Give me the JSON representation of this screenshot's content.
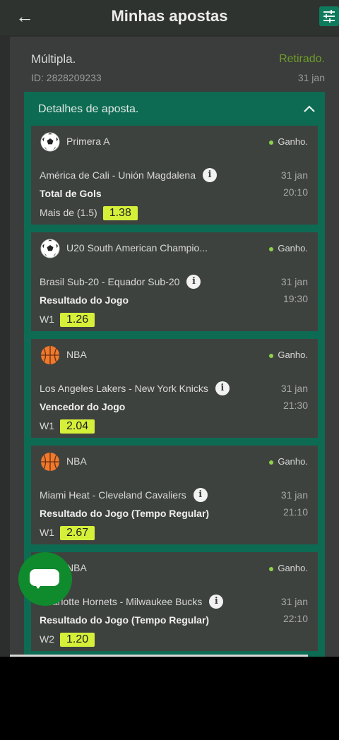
{
  "header": {
    "title": "Minhas apostas",
    "back_icon": "arrow-left-icon",
    "filter_icon": "sliders-icon"
  },
  "bet": {
    "type": "Múltipla.",
    "id": "ID: 2828209233",
    "status": "Retirado.",
    "date": "31 jan"
  },
  "details": {
    "label": "Detalhes de aposta."
  },
  "legs": [
    {
      "sport": "soccer",
      "league": "Primera A",
      "result": "Ganho.",
      "teams": "América de Cali - Unión Magdalena",
      "date": "31 jan",
      "time": "20:10",
      "market": "Total de Gols",
      "pick": "Mais de (1.5)",
      "odds": "1.38"
    },
    {
      "sport": "soccer",
      "league": "U20 South American Champio...",
      "result": "Ganho.",
      "teams": "Brasil Sub-20 - Equador Sub-20",
      "date": "31 jan",
      "time": "19:30",
      "market": "Resultado do Jogo",
      "pick": "W1",
      "odds": "1.26"
    },
    {
      "sport": "basketball",
      "league": "NBA",
      "result": "Ganho.",
      "teams": "Los Angeles Lakers - New York Knicks",
      "date": "31 jan",
      "time": "21:30",
      "market": "Vencedor do Jogo",
      "pick": "W1",
      "odds": "2.04"
    },
    {
      "sport": "basketball",
      "league": "NBA",
      "result": "Ganho.",
      "teams": "Miami Heat - Cleveland Cavaliers",
      "date": "31 jan",
      "time": "21:10",
      "market": "Resultado do Jogo (Tempo Regular)",
      "pick": "W1",
      "odds": "2.67"
    },
    {
      "sport": "basketball",
      "league": "NBA",
      "result": "Ganho.",
      "teams": "Charlotte Hornets - Milwaukee Bucks",
      "date": "31 jan",
      "time": "22:10",
      "market": "Resultado do Jogo (Tempo Regular)",
      "pick": "W2",
      "odds": "1.20"
    }
  ],
  "colors": {
    "accent": "#0d6b53",
    "won_dot": "#8ed24a",
    "odds_bg": "#d6f03a",
    "status_withdrawn": "#6f9c2a"
  }
}
